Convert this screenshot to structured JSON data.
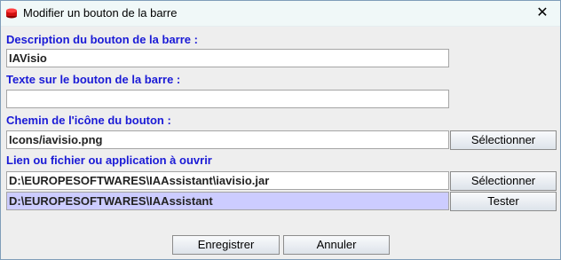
{
  "window": {
    "title": "Modifier un bouton de la barre",
    "close_glyph": "✕"
  },
  "form": {
    "description": {
      "label": "Description du bouton de la barre :",
      "value": "IAVisio"
    },
    "tooltip": {
      "label": "Texte sur le bouton de la barre :",
      "value": ""
    },
    "icon_path": {
      "label": "Chemin de l'icône du bouton :",
      "value": "Icons/iavisio.png",
      "button_label": "Sélectionner"
    },
    "target": {
      "label": "Lien ou fichier ou application à ouvrir",
      "value": "D:\\EUROPESOFTWARES\\IAAssistant\\iavisio.jar",
      "button_label": "Sélectionner"
    },
    "working_dir": {
      "value": "D:\\EUROPESOFTWARES\\IAAssistant",
      "button_label": "Tester"
    }
  },
  "footer": {
    "save_label": "Enregistrer",
    "cancel_label": "Annuler"
  },
  "colors": {
    "label_blue": "#1a1ad6",
    "highlight_field": "#ccccff",
    "titlebar_bg": "#f0f8f8",
    "window_bg": "#eeeeee"
  },
  "icons": {
    "app_icon": "red-cylinder-icon",
    "close": "close-icon"
  }
}
